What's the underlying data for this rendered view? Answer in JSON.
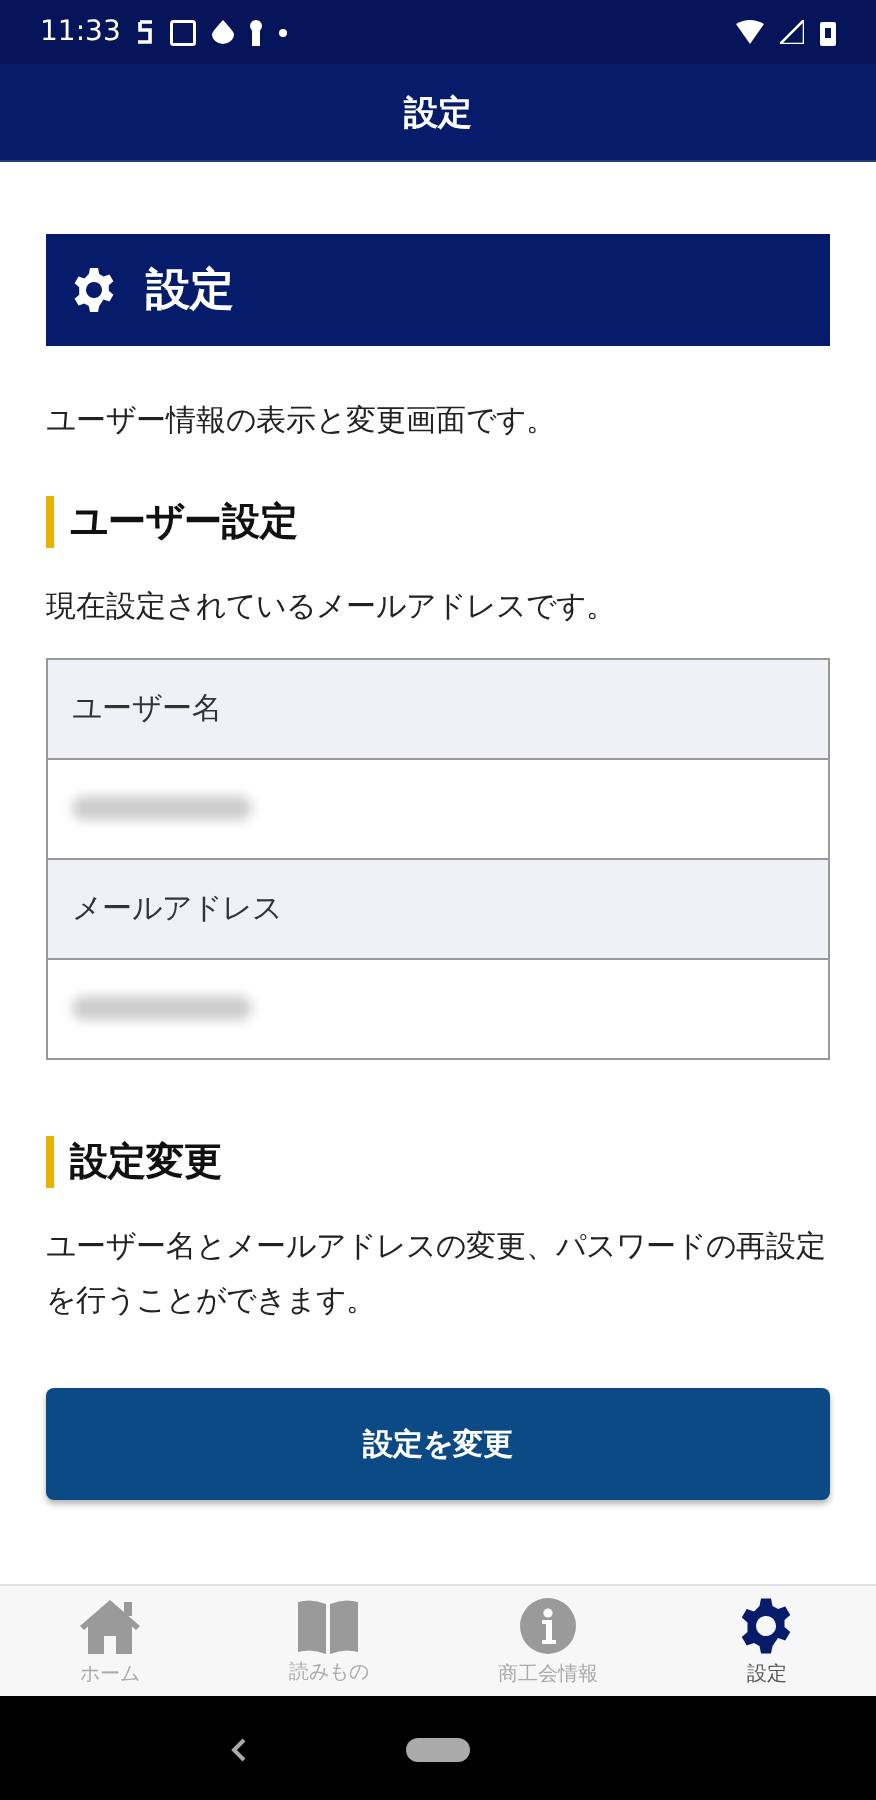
{
  "status_bar": {
    "time": "11:33"
  },
  "app_bar": {
    "title": "設定"
  },
  "page_heading": "設定",
  "intro": "ユーザー情報の表示と変更画面です。",
  "sections": [
    {
      "title": "ユーザー設定",
      "text": "現在設定されているメールアドレスです。",
      "table": [
        {
          "kind": "label",
          "text": "ユーザー名"
        },
        {
          "kind": "redacted"
        },
        {
          "kind": "label",
          "text": "メールアドレス"
        },
        {
          "kind": "redacted"
        }
      ]
    },
    {
      "title": "設定変更",
      "text": "ユーザー名とメールアドレスの変更、パスワードの再設定を行うことができます。",
      "button": "設定を変更"
    }
  ],
  "bottom_nav": [
    {
      "label": "ホーム",
      "kind": "home",
      "selected": false
    },
    {
      "label": "読みもの",
      "kind": "book",
      "selected": false
    },
    {
      "label": "商工会情報",
      "kind": "info",
      "selected": false
    },
    {
      "label": "設定",
      "kind": "gear",
      "selected": true
    }
  ]
}
